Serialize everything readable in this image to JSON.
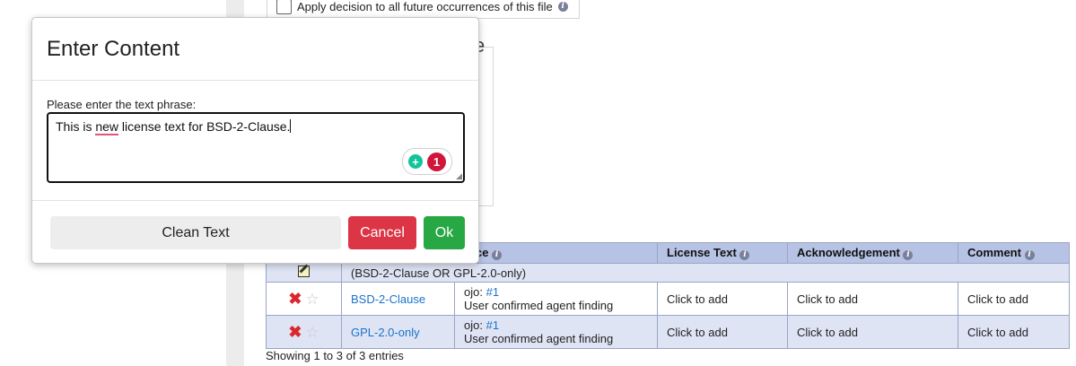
{
  "background": {
    "apply_checkbox_label": "Apply decision to all future occurrences of this file",
    "ghost_title_fragment": "e"
  },
  "table": {
    "headers": [
      "urce",
      "License Text",
      "Acknowledgement",
      "Comment"
    ],
    "expression": "(BSD-2-Clause OR GPL-2.0-only)",
    "rows": [
      {
        "license": "BSD-2-Clause",
        "source_prefix": "ojo:",
        "source_link": "#1",
        "source_note": "User confirmed agent finding",
        "license_text": "Click to add",
        "acknowledgement": "Click to add",
        "comment": "Click to add"
      },
      {
        "license": "GPL-2.0-only",
        "source_prefix": "ojo:",
        "source_link": "#1",
        "source_note": "User confirmed agent finding",
        "license_text": "Click to add",
        "acknowledgement": "Click to add",
        "comment": "Click to add"
      }
    ],
    "entries_info": "Showing 1 to 3 of 3 entries"
  },
  "modal": {
    "title": "Enter Content",
    "prompt": "Please enter the text phrase:",
    "text_before": "This is ",
    "text_misspelled": "new",
    "text_after": " license text for BSD-2-Clause.",
    "grammar_count": "1",
    "buttons": {
      "clean": "Clean Text",
      "cancel": "Cancel",
      "ok": "Ok"
    }
  },
  "icons": {
    "info": "info-icon",
    "delete": "x-icon",
    "favorite": "star-icon",
    "edit": "edit-icon",
    "grammar": "bulb-icon"
  },
  "colors": {
    "header_bg": "#b7c3e4",
    "row_alt_bg": "#dfe4f5",
    "link": "#1a73c9",
    "cancel": "#dc3545",
    "ok": "#28a745"
  }
}
